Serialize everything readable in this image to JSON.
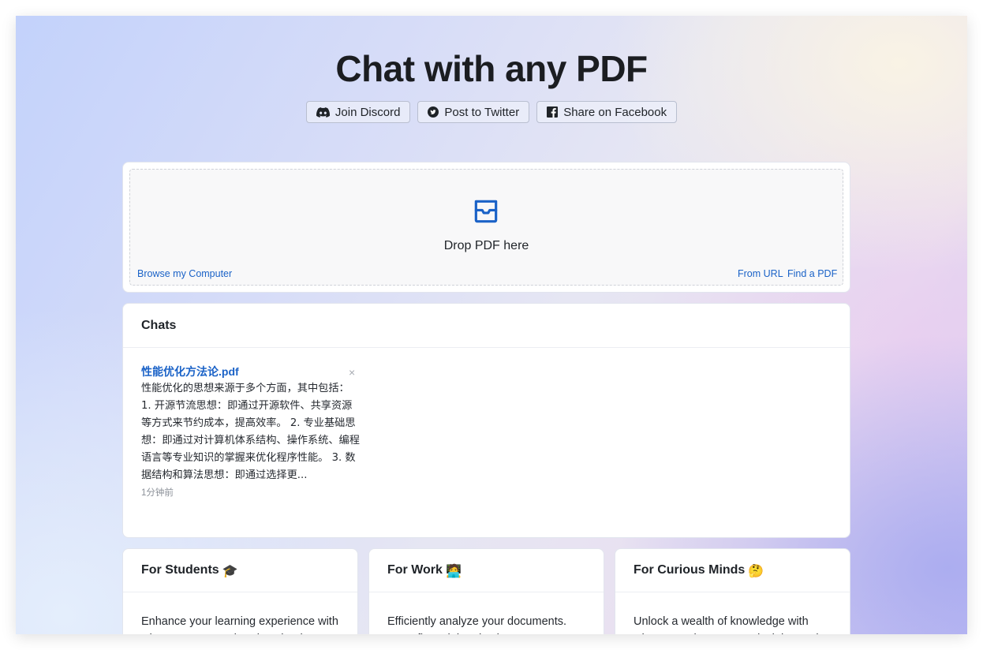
{
  "page": {
    "title": "Chat with any PDF"
  },
  "social_buttons": [
    {
      "label": "Join Discord",
      "icon": "discord-icon"
    },
    {
      "label": "Post to Twitter",
      "icon": "twitter-icon"
    },
    {
      "label": "Share on Facebook",
      "icon": "facebook-icon"
    }
  ],
  "upload": {
    "icon": "inbox-icon",
    "drop_text": "Drop PDF here",
    "browse_label": "Browse my Computer",
    "from_url_label": "From URL",
    "find_pdf_label": "Find a PDF"
  },
  "chats": {
    "heading": "Chats",
    "items": [
      {
        "title": "性能优化方法论.pdf",
        "snippet": "性能优化的思想来源于多个方面，其中包括： 1. 开源节流思想：即通过开源软件、共享资源等方式来节约成本，提高效率。 2. 专业基础思想：即通过对计算机体系结构、操作系统、编程语言等专业知识的掌握来优化程序性能。 3. 数据结构和算法思想：即通过选择更...",
        "time": "1分钟前",
        "close_glyph": "×"
      }
    ]
  },
  "features": [
    {
      "title": "For Students",
      "emoji": "🎓",
      "body": "Enhance your learning experience with ChatPDF. Comprehend textbooks,"
    },
    {
      "title": "For Work",
      "emoji": "🧑‍💻",
      "body": "Efficiently analyze your documents. From financial and sales reports to"
    },
    {
      "title": "For Curious Minds",
      "emoji": "🤔",
      "body": "Unlock a wealth of knowledge with ChatPDF. Discover new insights and"
    }
  ],
  "colors": {
    "link": "#1a62c7",
    "accent_icon": "#1a62c7"
  }
}
